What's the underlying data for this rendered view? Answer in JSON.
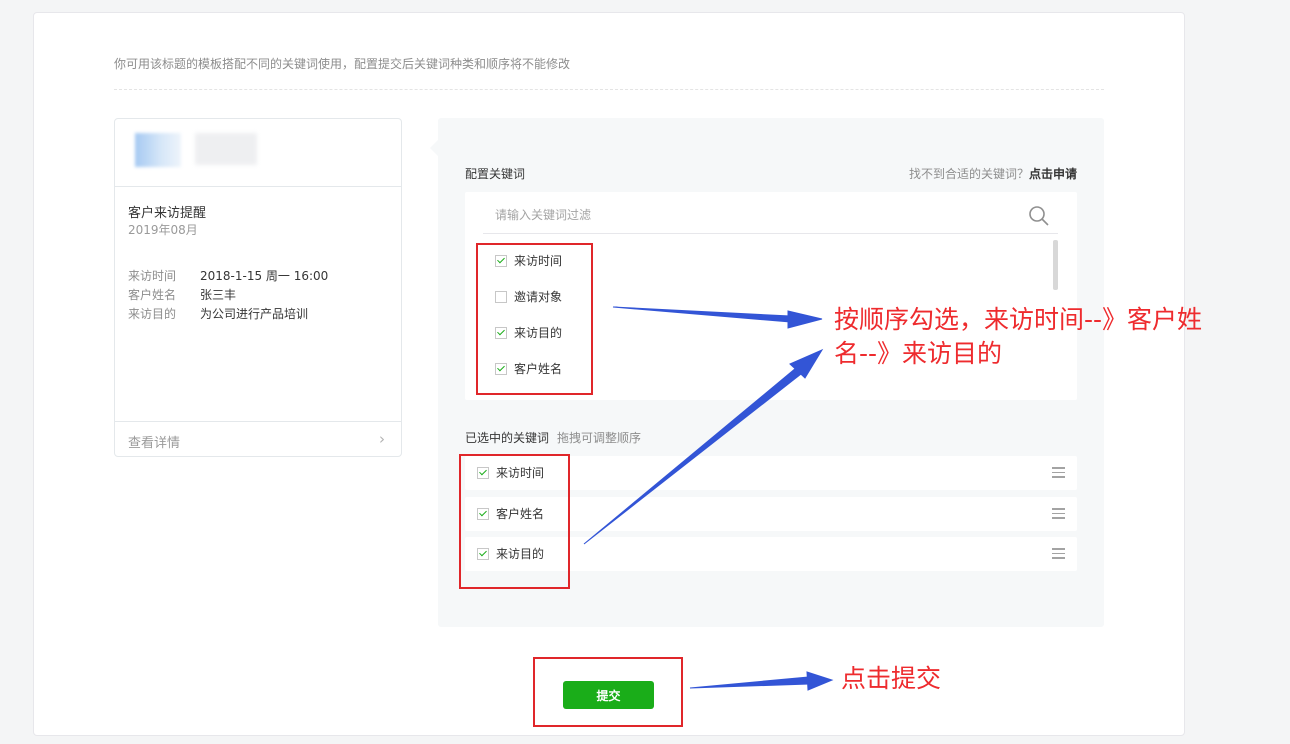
{
  "intro": "你可用该标题的模板搭配不同的关键词使用，配置提交后关键词种类和顺序将不能修改",
  "preview": {
    "title": "客户来访提醒",
    "date": "2019年08月",
    "fields": [
      {
        "key": "来访时间",
        "value": "2018-1-15 周一 16:00"
      },
      {
        "key": "客户姓名",
        "value": "张三丰"
      },
      {
        "key": "来访目的",
        "value": "为公司进行产品培训"
      }
    ],
    "footer": "查看详情",
    "footer_chevron": "›"
  },
  "config": {
    "title": "配置关键词",
    "help_prefix": "找不到合适的关键词？",
    "help_link": "点击申请",
    "search_placeholder": "请输入关键词过滤",
    "options": [
      {
        "label": "来访时间",
        "checked": true
      },
      {
        "label": "邀请对象",
        "checked": false
      },
      {
        "label": "来访目的",
        "checked": true
      },
      {
        "label": "客户姓名",
        "checked": true
      }
    ],
    "selected_title": "已选中的关键词",
    "selected_hint": "拖拽可调整顺序",
    "selected": [
      {
        "label": "来访时间",
        "checked": true
      },
      {
        "label": "客户姓名",
        "checked": true
      },
      {
        "label": "来访目的",
        "checked": true
      }
    ]
  },
  "submit_label": "提交",
  "annotations": {
    "order_line1": "按顺序勾选，来访时间--》客户姓",
    "order_line2": "名--》来访目的",
    "submit_note": "点击提交"
  },
  "colors": {
    "accent": "#1aad19",
    "annotation_red": "#e0262a",
    "annotation_text": "#ee2b2e",
    "arrow_blue": "#3355d6",
    "panel_bg": "#f6f8f9"
  },
  "icons": [
    "search-icon",
    "chevron-right-icon",
    "drag-handle-icon",
    "checkbox-icon",
    "arrow-icon"
  ]
}
